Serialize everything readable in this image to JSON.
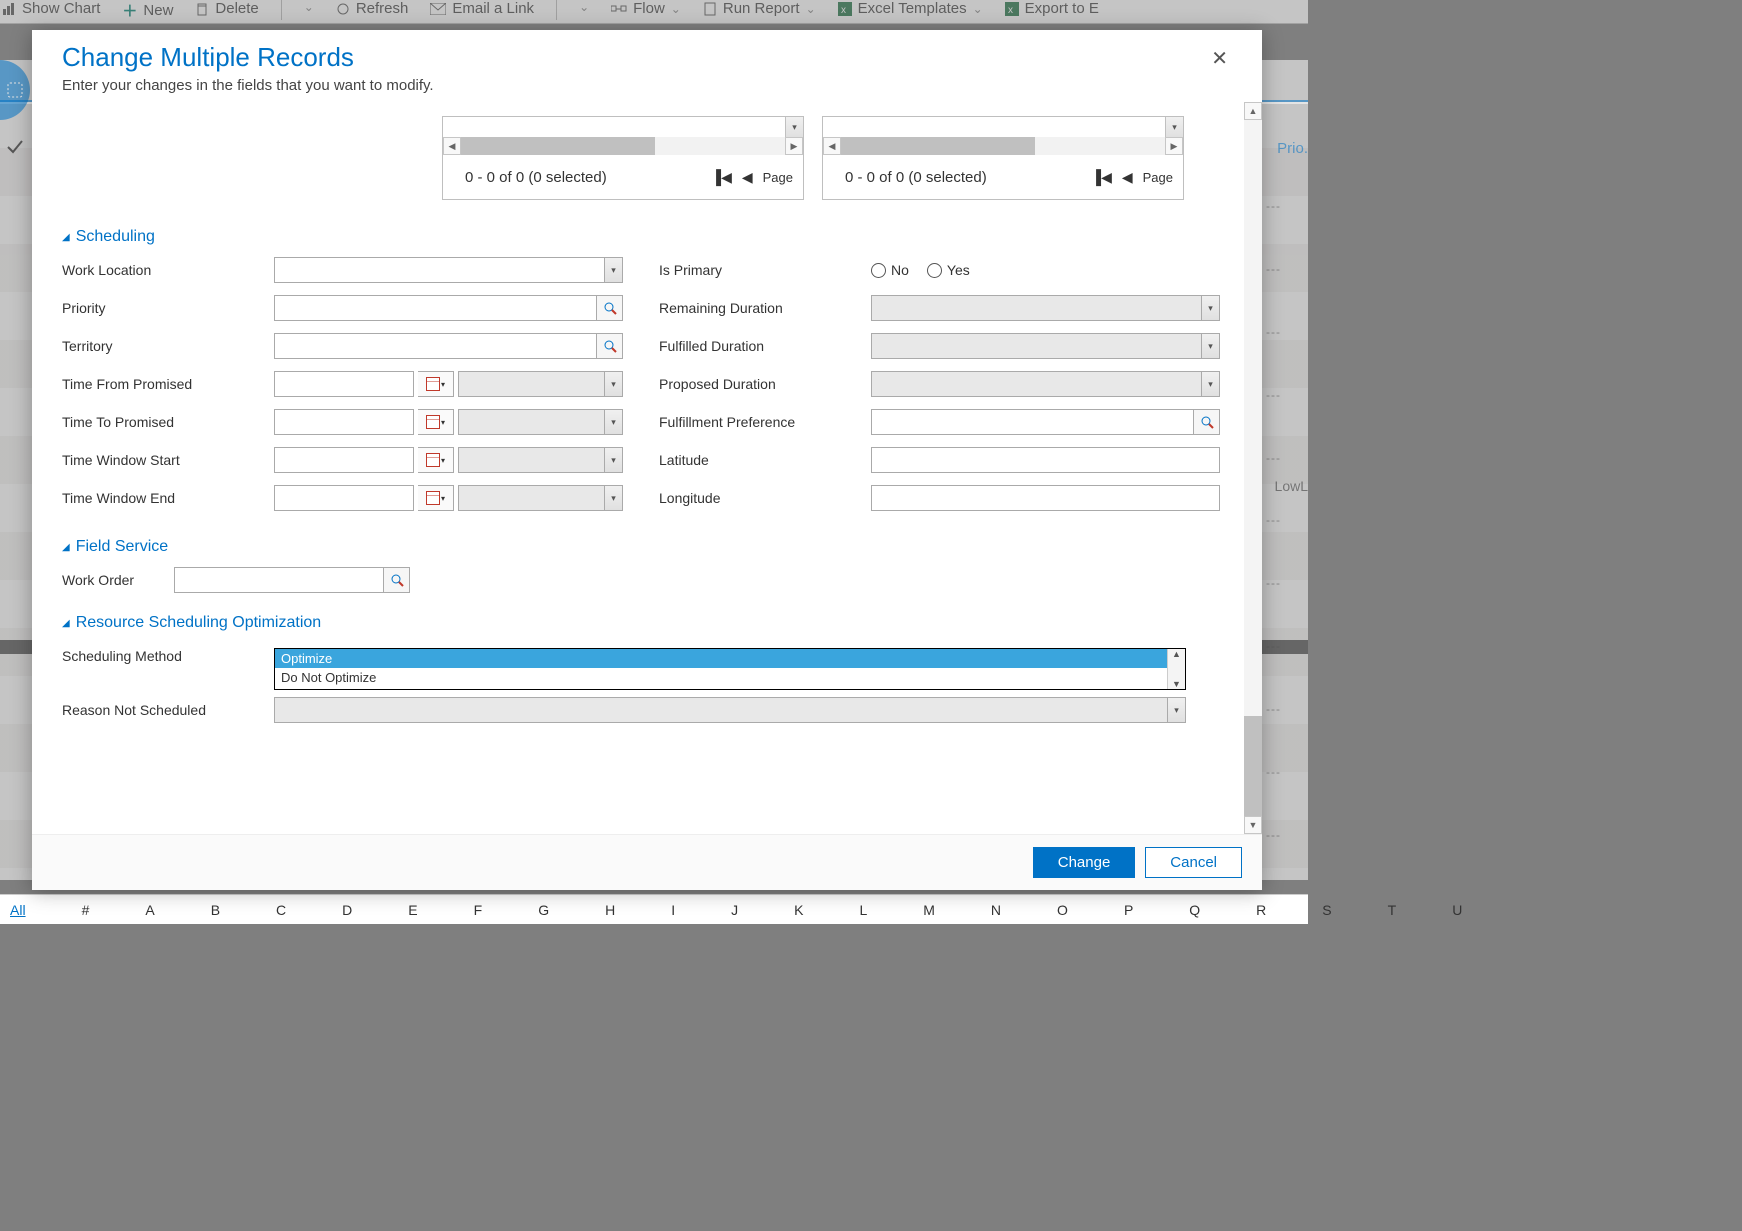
{
  "toolbar": {
    "show_chart": "Show Chart",
    "new": "New",
    "delete": "Delete",
    "refresh": "Refresh",
    "email_link": "Email a Link",
    "flow": "Flow",
    "run_report": "Run Report",
    "excel_templates": "Excel Templates",
    "export_excel": "Export to E"
  },
  "dashes_col": "---",
  "right_hdr1": "Prio.",
  "right_hdr2": "LowL",
  "modal": {
    "title": "Change Multiple Records",
    "subtitle": "Enter your changes in the fields that you want to modify.",
    "change": "Change",
    "cancel": "Cancel"
  },
  "gridpanel": {
    "status": "0 - 0 of 0 (0 selected)",
    "page": "Page"
  },
  "sections": {
    "scheduling": "Scheduling",
    "field_service": "Field Service",
    "rso": "Resource Scheduling Optimization"
  },
  "labels": {
    "work_location": "Work Location",
    "priority": "Priority",
    "territory": "Territory",
    "time_from_promised": "Time From Promised",
    "time_to_promised": "Time To Promised",
    "time_window_start": "Time Window Start",
    "time_window_end": "Time Window End",
    "is_primary": "Is Primary",
    "remaining_duration": "Remaining Duration",
    "fulfilled_duration": "Fulfilled Duration",
    "proposed_duration": "Proposed Duration",
    "fulfillment_preference": "Fulfillment Preference",
    "latitude": "Latitude",
    "longitude": "Longitude",
    "work_order": "Work Order",
    "scheduling_method": "Scheduling Method",
    "reason_not_scheduled": "Reason Not Scheduled"
  },
  "radio": {
    "no": "No",
    "yes": "Yes"
  },
  "scheduling_method": {
    "options": {
      "optimize": "Optimize",
      "do_not_optimize": "Do Not Optimize"
    }
  },
  "alpha": {
    "all": "All",
    "hash": "#",
    "letters": [
      "A",
      "B",
      "C",
      "D",
      "E",
      "F",
      "G",
      "H",
      "I",
      "J",
      "K",
      "L",
      "M",
      "N",
      "O",
      "P",
      "Q",
      "R",
      "S",
      "T",
      "U"
    ]
  }
}
